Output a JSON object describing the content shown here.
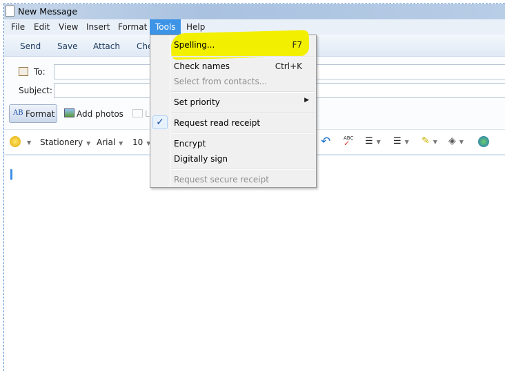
{
  "window": {
    "title": "New Message"
  },
  "menubar": [
    "File",
    "Edit",
    "View",
    "Insert",
    "Format",
    "Tools",
    "Help"
  ],
  "toolbar": {
    "send": "Send",
    "save": "Save",
    "attach": "Attach",
    "check": "Che"
  },
  "header": {
    "to_label": "To:",
    "to_value": "",
    "subject_label": "Subject:",
    "subject_value": "",
    "format_button": "Format",
    "add_photos": "Add photos",
    "layout_partial": "L"
  },
  "format_toolbar": {
    "emoticon": "emoticon-icon",
    "stationery": "Stationery",
    "font": "Arial",
    "size": "10"
  },
  "tools_menu": {
    "spelling": "Spelling...",
    "spelling_shortcut": "F7",
    "check_names": "Check names",
    "check_names_shortcut": "Ctrl+K",
    "select_contacts": "Select from contacts...",
    "set_priority": "Set priority",
    "read_receipt": "Request read receipt",
    "read_receipt_checked": true,
    "encrypt": "Encrypt",
    "sign": "Digitally sign",
    "secure_receipt": "Request secure receipt"
  },
  "colors": {
    "highlight": "#f2f000",
    "menu_active": "#3d94e6"
  }
}
